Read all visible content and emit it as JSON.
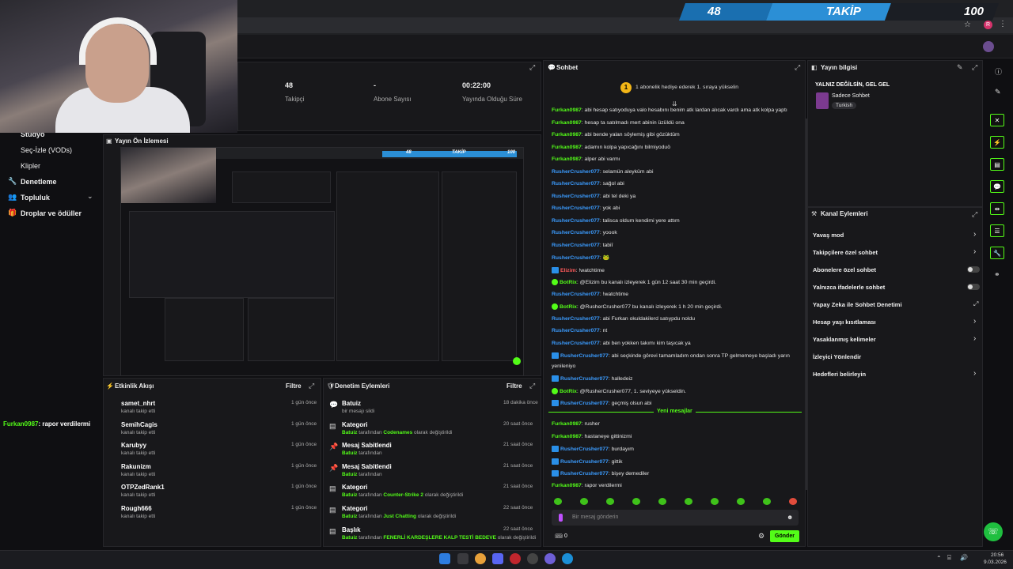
{
  "goal": {
    "current": "48",
    "label": "TAKİP",
    "target": "100"
  },
  "stats": [
    {
      "value": "48",
      "label": "Takipçi"
    },
    {
      "value": "-",
      "label": "Abone Sayısı"
    },
    {
      "value": "00:22:00",
      "label": "Yayında Olduğu Süre"
    }
  ],
  "sidebar": {
    "items": [
      {
        "label": "Stüdyo"
      },
      {
        "label": "Seç-İzle (VODs)"
      },
      {
        "label": "Klipler"
      },
      {
        "label": "Denetleme"
      },
      {
        "label": "Topluluk"
      },
      {
        "label": "Droplar ve ödüller"
      }
    ],
    "overlay_chat": {
      "user": "Furkan0987",
      "text": ": rapor verdilermi"
    }
  },
  "preview": {
    "title": "Yayın Ön İzlemesi",
    "mini_goal_left": "48",
    "mini_goal_mid": "TAKİP",
    "mini_goal_right": "100"
  },
  "activity": {
    "title": "Etkinlik Akışı",
    "filter": "Filtre",
    "rows": [
      {
        "name": "samet_nhrt",
        "sub": "kanalı takip etti",
        "time": "1 gün önce"
      },
      {
        "name": "SemihCagis",
        "sub": "kanalı takip etti",
        "time": "1 gün önce"
      },
      {
        "name": "Karubyy",
        "sub": "kanalı takip etti",
        "time": "1 gün önce"
      },
      {
        "name": "Rakunizm",
        "sub": "kanalı takip etti",
        "time": "1 gün önce"
      },
      {
        "name": "OTPZedRank1",
        "sub": "kanalı takip etti",
        "time": "1 gün önce"
      },
      {
        "name": "Rough666",
        "sub": "kanalı takip etti",
        "time": "1 gün önce"
      }
    ]
  },
  "moderation": {
    "title": "Denetim Eylemleri",
    "filter": "Filtre",
    "rows": [
      {
        "title": "Batuiz",
        "sub_user": "",
        "sub_text": "bir mesajı sildi",
        "sub_hl": "",
        "sub_tail": "",
        "time": "18 dakika önce"
      },
      {
        "title": "Kategori",
        "sub_user": "Batuiz",
        "sub_text": " tarafından ",
        "sub_hl": "Codenames",
        "sub_tail": " olarak değiştirildi",
        "time": "20 saat önce"
      },
      {
        "title": "Mesaj Sabitlendi",
        "sub_user": "Batuiz",
        "sub_text": " tarafından",
        "sub_hl": "",
        "sub_tail": "",
        "time": "21 saat önce"
      },
      {
        "title": "Mesaj Sabitlendi",
        "sub_user": "Batuiz",
        "sub_text": " tarafından",
        "sub_hl": "",
        "sub_tail": "",
        "time": "21 saat önce"
      },
      {
        "title": "Kategori",
        "sub_user": "Batuiz",
        "sub_text": " tarafından ",
        "sub_hl": "Counter-Strike 2",
        "sub_tail": " olarak değiştirildi",
        "time": "21 saat önce"
      },
      {
        "title": "Kategori",
        "sub_user": "Batuiz",
        "sub_text": " tarafından ",
        "sub_hl": "Just Chatting",
        "sub_tail": " olarak değiştirildi",
        "time": "22 saat önce"
      },
      {
        "title": "Başlık",
        "sub_user": "Batuiz",
        "sub_text": " tarafından ",
        "sub_hl": "FENERLİ KARDEŞLERE KALP TESTİ BEDEVE",
        "sub_tail": " olarak değiştirildi",
        "time": "22 saat önce"
      }
    ]
  },
  "chat": {
    "title": "Sohbet",
    "pinned": "1 abonelik hediye ederek 1. sıraya yükselin",
    "messages": [
      {
        "user": "Furkan0987",
        "color": "#53fc18",
        "badge": "",
        "text": ": abi hesap satıyoduya valo hesabını benim atk lardan alıcak vardı ama atk kolpa yaptı"
      },
      {
        "user": "Furkan0987",
        "color": "#53fc18",
        "badge": "",
        "text": ": hesap ta satılmadı mert abinin üzüldü ona"
      },
      {
        "user": "Furkan0987",
        "color": "#53fc18",
        "badge": "",
        "text": ": abi bende yalan söylemiş gibi gözüktüm"
      },
      {
        "user": "Furkan0987",
        "color": "#53fc18",
        "badge": "",
        "text": ": adamın kolpa yapıcağını bilmiyoduö"
      },
      {
        "user": "Furkan0987",
        "color": "#53fc18",
        "badge": "",
        "text": ": alper abi varmı"
      },
      {
        "user": "RusherCrusher077",
        "color": "#3b9cff",
        "badge": "",
        "text": ": selamün aleyküm abi"
      },
      {
        "user": "RusherCrusher077",
        "color": "#3b9cff",
        "badge": "",
        "text": ": sağol abi"
      },
      {
        "user": "RusherCrusher077",
        "color": "#3b9cff",
        "badge": "",
        "text": ": abi tel deki ya"
      },
      {
        "user": "RusherCrusher077",
        "color": "#3b9cff",
        "badge": "",
        "text": ": yok abi"
      },
      {
        "user": "RusherCrusher077",
        "color": "#3b9cff",
        "badge": "",
        "text": ": talisca oldum kendimi yere attım"
      },
      {
        "user": "RusherCrusher077",
        "color": "#3b9cff",
        "badge": "",
        "text": ": yoook"
      },
      {
        "user": "RusherCrusher077",
        "color": "#3b9cff",
        "badge": "",
        "text": ": tabiî"
      },
      {
        "user": "RusherCrusher077",
        "color": "#3b9cff",
        "badge": "",
        "text": ": 🐸"
      },
      {
        "user": "Elizim",
        "color": "#ff5a5a",
        "badge": "kick",
        "text": ": !watchtime"
      },
      {
        "user": "BotRix",
        "color": "#53fc18",
        "badge": "bot",
        "text": ": @Elizim bu kanalı izleyerek 1 gün 12 saat 30 min geçirdi."
      },
      {
        "user": "RusherCrusher077",
        "color": "#3b9cff",
        "badge": "",
        "text": ": !watchtime"
      },
      {
        "user": "BotRix",
        "color": "#53fc18",
        "badge": "bot",
        "text": ": @RusherCrusher077 bu kanalı izleyerek 1 h 20 min geçirdi."
      },
      {
        "user": "RusherCrusher077",
        "color": "#3b9cff",
        "badge": "",
        "text": ": abi Furkan okuldakilerd satıypdu noldu"
      },
      {
        "user": "RusherCrusher077",
        "color": "#3b9cff",
        "badge": "",
        "text": ": nt"
      },
      {
        "user": "RusherCrusher077",
        "color": "#3b9cff",
        "badge": "",
        "text": ": abi ben yokken takımı kim taşıcak ya"
      },
      {
        "user": "RusherCrusher077",
        "color": "#3b9cff",
        "badge": "kick",
        "text": ": abi seçkinde görevi tamamladım ondan sonra TP gelmemeye başladı yarın"
      },
      {
        "user": "",
        "color": "#e6e6e6",
        "badge": "",
        "text": "yenileniyo"
      },
      {
        "user": "RusherCrusher077",
        "color": "#3b9cff",
        "badge": "kick",
        "text": ": halledeiz"
      },
      {
        "user": "BotRix",
        "color": "#53fc18",
        "badge": "bot",
        "text": ": @RusherCrusher077, 1. seviyeye yükseldin."
      },
      {
        "user": "RusherCrusher077",
        "color": "#3b9cff",
        "badge": "kick",
        "text": ": geçmiş olsun abi"
      }
    ],
    "new_label": "Yeni mesajlar",
    "new_messages": [
      {
        "user": "Furkan0987",
        "color": "#53fc18",
        "badge": "",
        "text": ": rusher"
      },
      {
        "user": "Furkan0987",
        "color": "#53fc18",
        "badge": "",
        "text": ": hastaneye gittinizmi"
      },
      {
        "user": "RusherCrusher077",
        "color": "#3b9cff",
        "badge": "kick",
        "text": ": burdayım"
      },
      {
        "user": "RusherCrusher077",
        "color": "#3b9cff",
        "badge": "kick",
        "text": ": gittik"
      },
      {
        "user": "RusherCrusher077",
        "color": "#3b9cff",
        "badge": "kick",
        "text": ": bişey demediler"
      },
      {
        "user": "Furkan0987",
        "color": "#53fc18",
        "badge": "",
        "text": ": rapor verdilermi"
      }
    ],
    "input_placeholder": "Bir mesaj gönderin",
    "points": "0",
    "send": "Gönder"
  },
  "stream_info": {
    "title": "Yayın bilgisi",
    "stream_title": "YALNIZ DEĞİLSİN, GEL GEL",
    "category": "Sadece Sohbet",
    "language": "Turkish"
  },
  "channel_actions": {
    "title": "Kanal Eylemleri",
    "items": [
      {
        "label": "Yavaş mod",
        "control": "chevron"
      },
      {
        "label": "Takipçilere özel sohbet",
        "control": "chevron"
      },
      {
        "label": "Abonelere özel sohbet",
        "control": "toggle"
      },
      {
        "label": "Yalnızca ifadelerle sohbet",
        "control": "toggle"
      },
      {
        "label": "Yapay Zeka ile Sohbet Denetimi",
        "control": "external"
      },
      {
        "label": "Hesap yaşı kısıtlaması",
        "control": "chevron"
      },
      {
        "label": "Yasaklanmış kelimeler",
        "control": "chevron"
      },
      {
        "label": "İzleyici Yönlendir",
        "control": ""
      },
      {
        "label": "Hedefleri belirleyin",
        "control": "chevron"
      }
    ]
  },
  "taskbar": {
    "time": "20:56",
    "date": "9.03.2026"
  },
  "colors": {
    "accent": "#53fc18",
    "kick_blue": "#3b9cff",
    "bg": "#0f0f12",
    "panel": "#18181b"
  }
}
